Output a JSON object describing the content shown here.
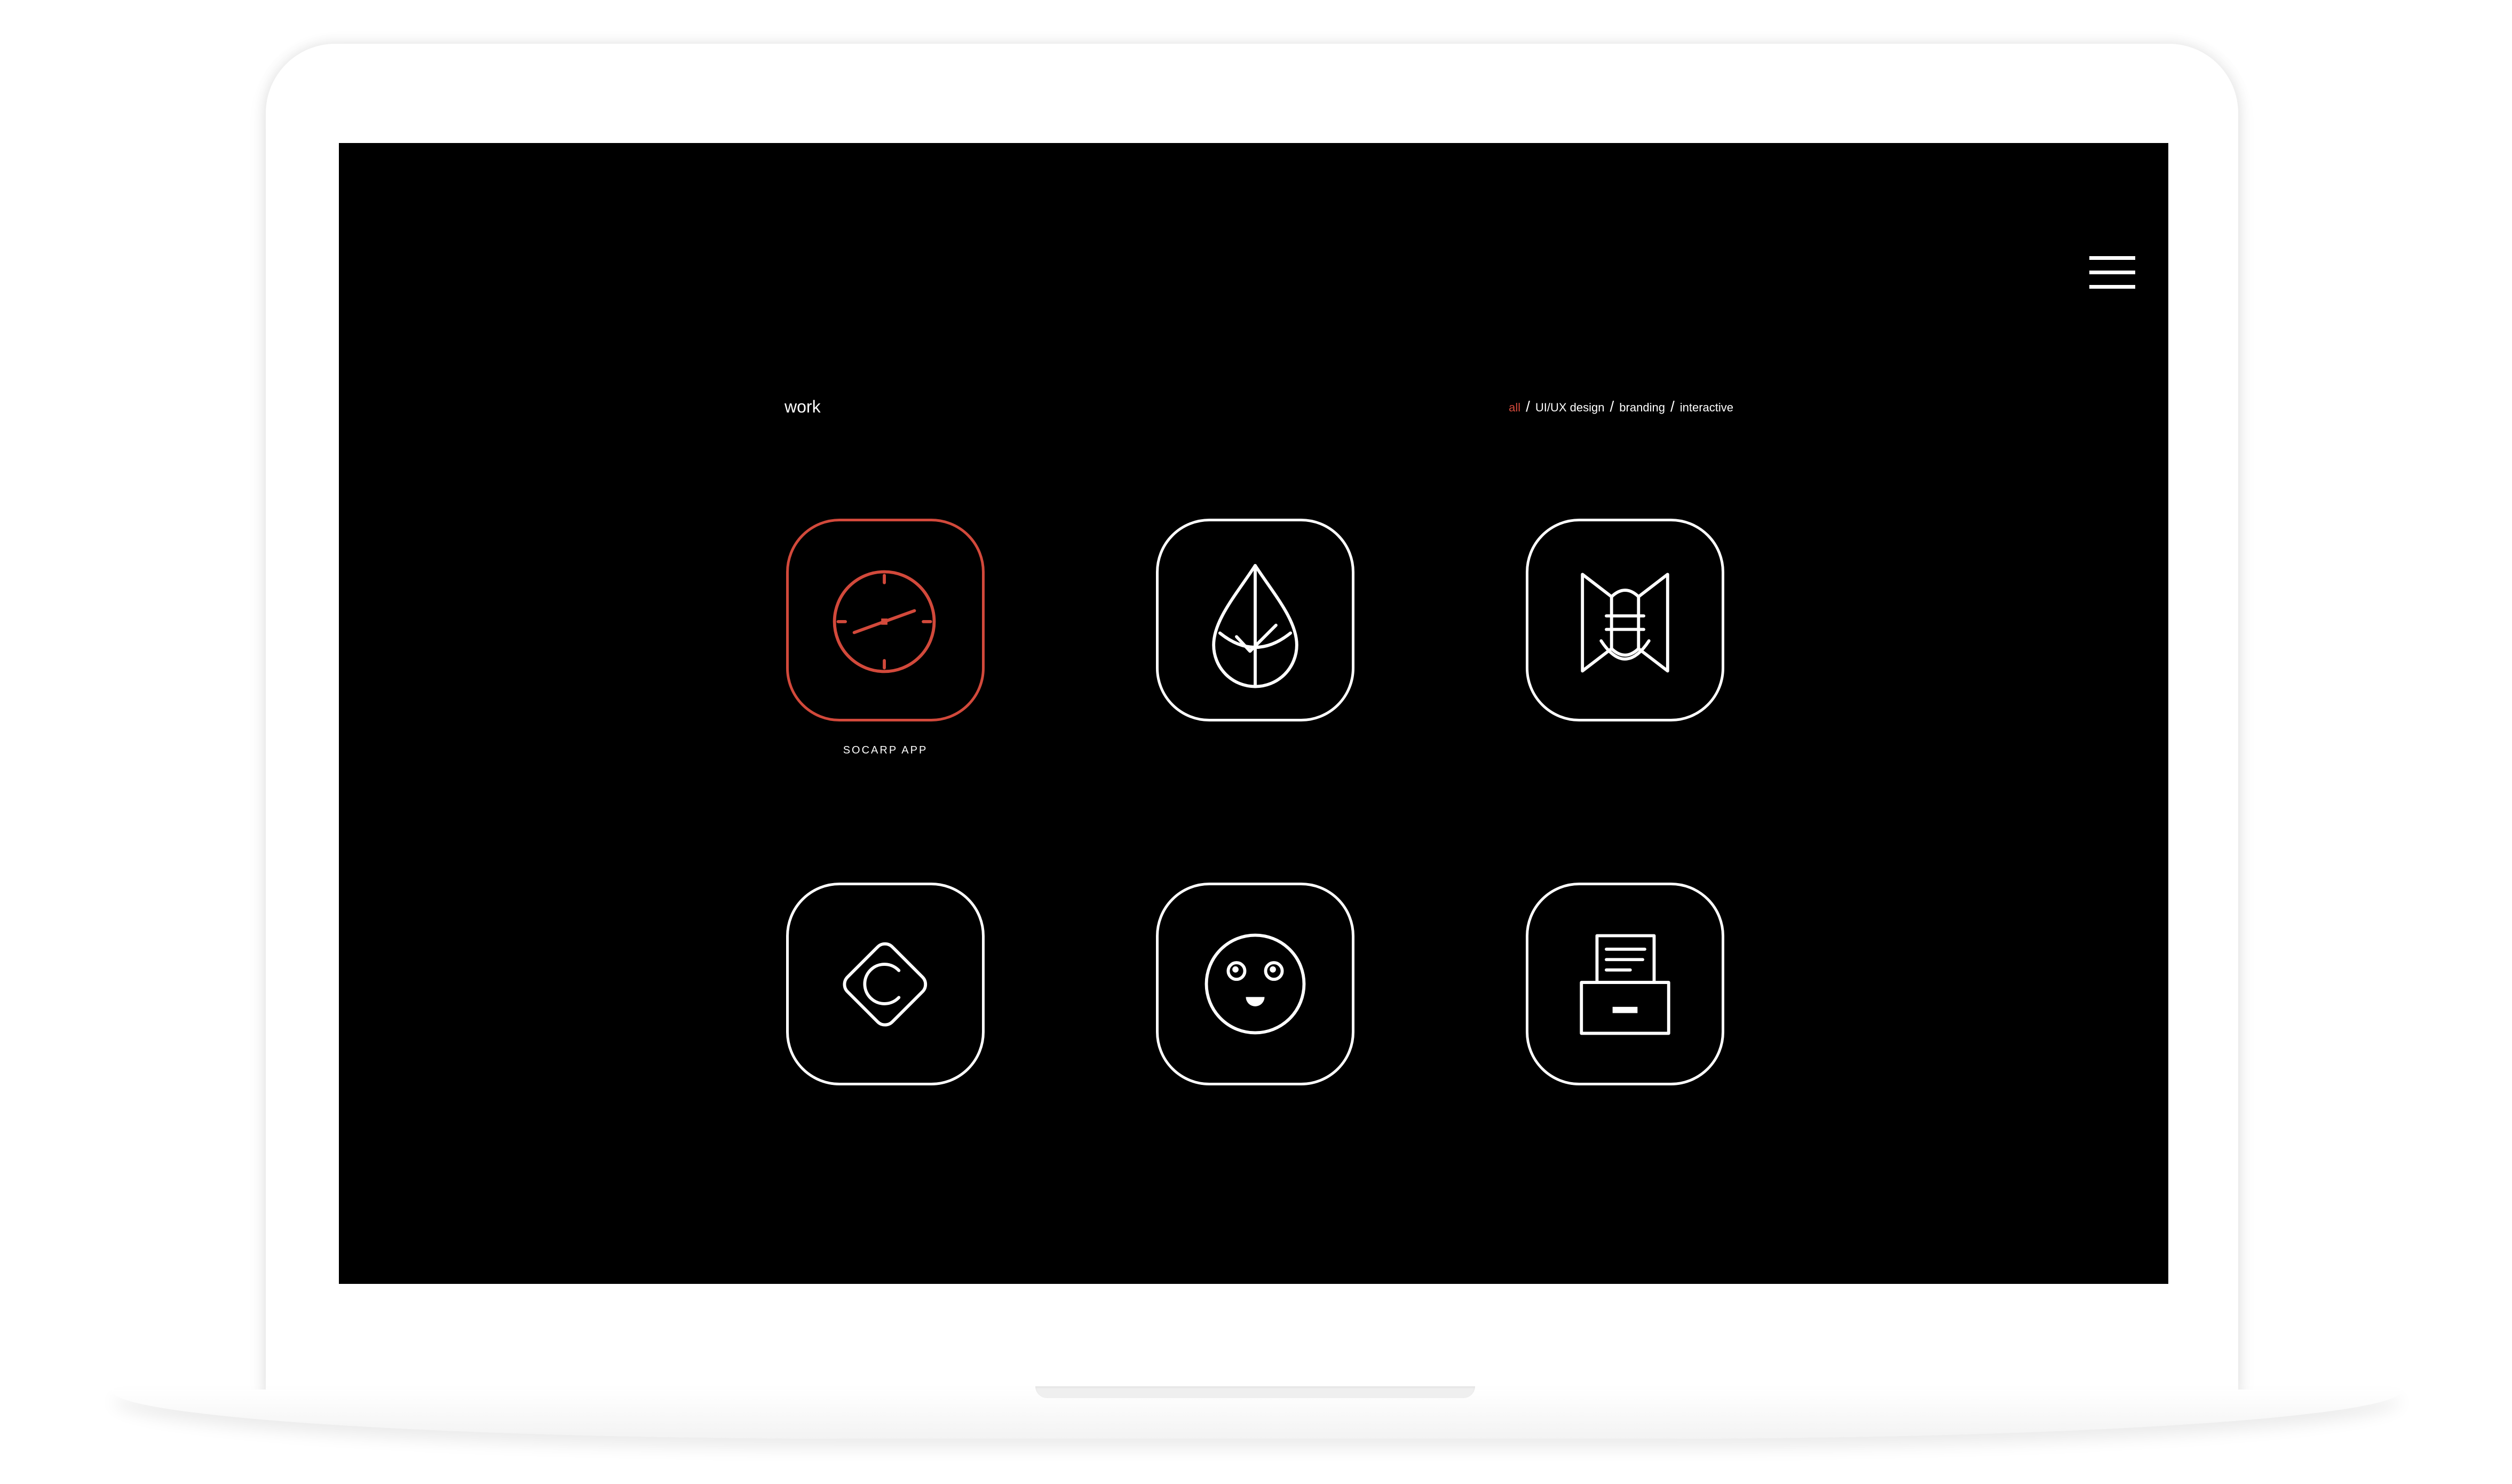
{
  "header": {
    "section_title": "work",
    "filters": [
      "all",
      "UI/UX design",
      "branding",
      "interactive"
    ],
    "filter_separator": "/"
  },
  "colors": {
    "accent": "#d2493b",
    "background": "#000000",
    "foreground": "#ffffff"
  },
  "projects": [
    {
      "icon": "clock-icon",
      "label": "SOCARP  APP",
      "active": true
    },
    {
      "icon": "water-drop-check-icon",
      "label": "",
      "active": false
    },
    {
      "icon": "geometric-emblem-icon",
      "label": "",
      "active": false
    },
    {
      "icon": "diamond-c-icon",
      "label": "",
      "active": false
    },
    {
      "icon": "smiley-face-icon",
      "label": "",
      "active": false
    },
    {
      "icon": "printer-document-icon",
      "label": "",
      "active": false
    }
  ],
  "menu": {
    "icon": "hamburger-menu-icon"
  }
}
